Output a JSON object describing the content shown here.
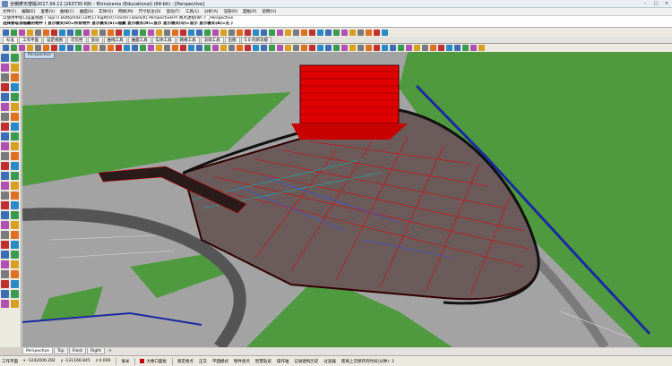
{
  "window": {
    "title": "全棚摩天楼版2017.04.12 (263730 KB) - Rhinoceros (Educational) (64-bit) - [Perspective]",
    "controls": [
      "–",
      "□",
      "✕"
    ]
  },
  "menu": [
    "文件(F)",
    "编辑(E)",
    "查看(V)",
    "曲线(C)",
    "曲面(S)",
    "实体(O)",
    "网格(M)",
    "尺寸标注(D)",
    "变动(T)",
    "工具(L)",
    "分析(A)",
    "渲染(R)",
    "面板(P)",
    "说明(H)"
  ],
  "command": {
    "history": "以使用中窗口设置视图 ( Top(T)  Bottom(B)  Left(L)  Right(R)  Front(F)  Back(K)  Perspective(P)  两点透视(W) ): _Perspective",
    "prompt": "选择要取消隐藏的物件 ( 显示模式(D)=所有物件  显示模式(S)=隐藏  显示模式(R)=显示  显示模式(Q)=显示  显示模式(A)=无 )"
  },
  "tabs": [
    "标准",
    "工作平面",
    "设定视图",
    "可见性",
    "变动",
    "曲线工具",
    "曲面工具",
    "实体工具",
    "网格工具",
    "渲染工具",
    "出图",
    "5.0 的新功能"
  ],
  "active_tab": "标准",
  "viewport": {
    "label": "Perspective"
  },
  "view_tabs": [
    "Perspective",
    "Top",
    "Front",
    "Right"
  ],
  "view_tabs_add": "+",
  "status": {
    "workplane_label": "工作平面",
    "x": "x -1242406.292",
    "y": "y -131166.845",
    "z": "z 0.000",
    "unit": "毫米",
    "layer": "大楼口面板",
    "toggles": [
      "锁定格点",
      "正交",
      "平面模式",
      "物件锁点",
      "智慧轨迹",
      "操作轴",
      "记录建构历史",
      "过滤器",
      "距离上次保存的时间(分钟): 3"
    ]
  }
}
